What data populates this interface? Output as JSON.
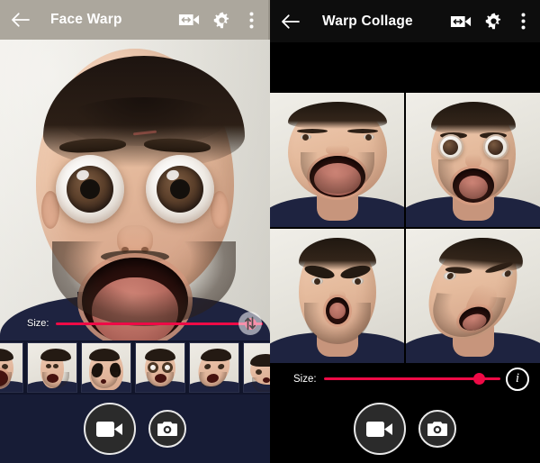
{
  "left_panel": {
    "topbar": {
      "back_icon": "arrow-back-icon",
      "title": "Face Warp",
      "flip_camera_icon": "video-flip-icon",
      "settings_icon": "gear-icon",
      "overflow_icon": "more-vertical-icon"
    },
    "preview": {
      "effect_name": "big-eyes-wide-mouth-warp"
    },
    "size_control": {
      "label": "Size:",
      "value_percent": 94,
      "track_color": "#ee0a46",
      "thumb_color": "#ee0a46",
      "flip_icon": "swap-vertical-icon"
    },
    "filmstrip": {
      "items": [
        {
          "name": "thumb-open-mouth",
          "variant": "v-bigmouth"
        },
        {
          "name": "thumb-pinched-face",
          "variant": "v-pinch"
        },
        {
          "name": "thumb-alien-eyes",
          "variant": "v-alien"
        },
        {
          "name": "thumb-bug-eyes-mouth",
          "variant": "v-eyes"
        },
        {
          "name": "thumb-twisted-face",
          "variant": "v-twist"
        },
        {
          "name": "thumb-squashed-face",
          "variant": "v-squash"
        }
      ]
    },
    "actions": {
      "record_icon": "video-camera-icon",
      "photo_icon": "camera-icon"
    }
  },
  "right_panel": {
    "topbar": {
      "back_icon": "arrow-back-icon",
      "title": "Warp Collage",
      "flip_camera_icon": "video-flip-icon",
      "settings_icon": "gear-icon",
      "overflow_icon": "more-vertical-icon"
    },
    "collage": {
      "rows": 2,
      "columns": 2,
      "cells": [
        {
          "name": "collage-cell-wide-mouth",
          "class": "cell-1"
        },
        {
          "name": "collage-cell-big-eyes",
          "class": "cell-2"
        },
        {
          "name": "collage-cell-angry-brows",
          "class": "cell-3"
        },
        {
          "name": "collage-cell-twisted",
          "class": "cell-4"
        }
      ]
    },
    "size_control": {
      "label": "Size:",
      "value_percent": 88,
      "track_color": "#ee0a46",
      "thumb_color": "#ee0a46",
      "info_icon": "info-icon",
      "info_label": "i"
    },
    "actions": {
      "record_icon": "video-camera-icon",
      "photo_icon": "camera-icon"
    }
  }
}
